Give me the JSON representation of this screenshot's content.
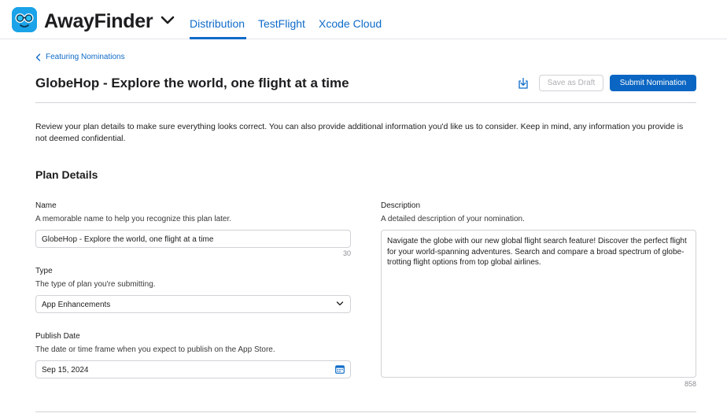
{
  "header": {
    "app_name": "AwayFinder",
    "tabs": [
      {
        "label": "Distribution",
        "active": true
      },
      {
        "label": "TestFlight",
        "active": false
      },
      {
        "label": "Xcode Cloud",
        "active": false
      }
    ]
  },
  "breadcrumb": {
    "label": "Featuring Nominations"
  },
  "page": {
    "title": "GlobeHop - Explore the world, one flight at a time",
    "save_draft_label": "Save as Draft",
    "submit_label": "Submit Nomination",
    "intro": "Review your plan details to make sure everything looks correct. You can also provide additional information you'd like us to consider. Keep in mind, any information you provide is not deemed confidential."
  },
  "plan": {
    "section_title": "Plan Details",
    "name": {
      "label": "Name",
      "hint": "A memorable name to help you recognize this plan later.",
      "value": "GlobeHop - Explore the world, one flight at a time",
      "counter": "30"
    },
    "type": {
      "label": "Type",
      "hint": "The type of plan you're submitting.",
      "value": "App Enhancements"
    },
    "publish_date": {
      "label": "Publish Date",
      "hint": "The date or time frame when you expect to publish on the App Store.",
      "value": "Sep 15, 2024"
    },
    "description": {
      "label": "Description",
      "hint": "A detailed description of your nomination.",
      "value": "Navigate the globe with our new global flight search feature! Discover the perfect flight for your world-spanning adventures. Search and compare a broad spectrum of globe-trotting flight options from top global airlines.",
      "counter": "858"
    }
  },
  "colors": {
    "accent": "#0f6bc9",
    "primary_button": "#0b66c3",
    "app_icon": "#1aa3e8"
  },
  "icons": [
    "app-icon",
    "chevron-down-icon",
    "chevron-left-icon",
    "download-icon",
    "calendar-icon"
  ]
}
